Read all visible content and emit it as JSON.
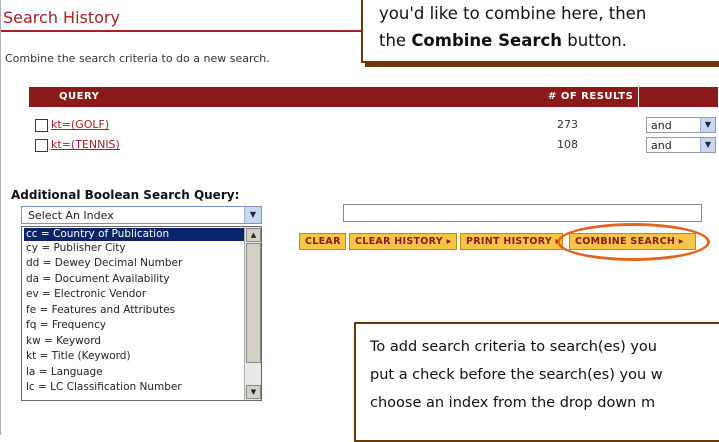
{
  "panel": {
    "title": "Search History",
    "instructions": "Combine the search criteria to do a new search."
  },
  "results_table": {
    "headers": {
      "query": "QUERY",
      "results": "# OF RESULTS"
    },
    "rows": [
      {
        "query": "kt=(GOLF)",
        "count": "273",
        "operator": "and"
      },
      {
        "query": "kt=(TENNIS)",
        "count": "108",
        "operator": "and"
      }
    ]
  },
  "boolean_section": {
    "label": "Additional Boolean Search Query:",
    "select_value": "Select An Index",
    "input_value": "",
    "options": [
      "cc = Country of Publication",
      "cy = Publisher City",
      "dd = Dewey Decimal Number",
      "da = Document Availability",
      "ev = Electronic Vendor",
      "fe = Features and Attributes",
      "fq = Frequency",
      "kw = Keyword",
      "kt = Title (Keyword)",
      "la = Language",
      "lc = LC Classification Number"
    ]
  },
  "buttons": {
    "clear": "CLEAR",
    "clear_history": "CLEAR HISTORY ▸",
    "print_history": "PRINT HISTORY ▸",
    "combine_search": "COMBINE SEARCH ▸"
  },
  "callout_top": {
    "line1": "you'd like to combine here, then",
    "line2_pre": "the ",
    "line2_bold": "Combine Search",
    "line2_post": " button."
  },
  "callout_bottom": {
    "line1": "To add search criteria to search(es) you",
    "line2": "put a check before the search(es) you w",
    "line3": "choose an index from the drop down m",
    "line4": ""
  },
  "colors": {
    "brand_red": "#8b1a1a",
    "button_yellow": "#f7c44a",
    "highlight_orange": "#e2661f"
  }
}
